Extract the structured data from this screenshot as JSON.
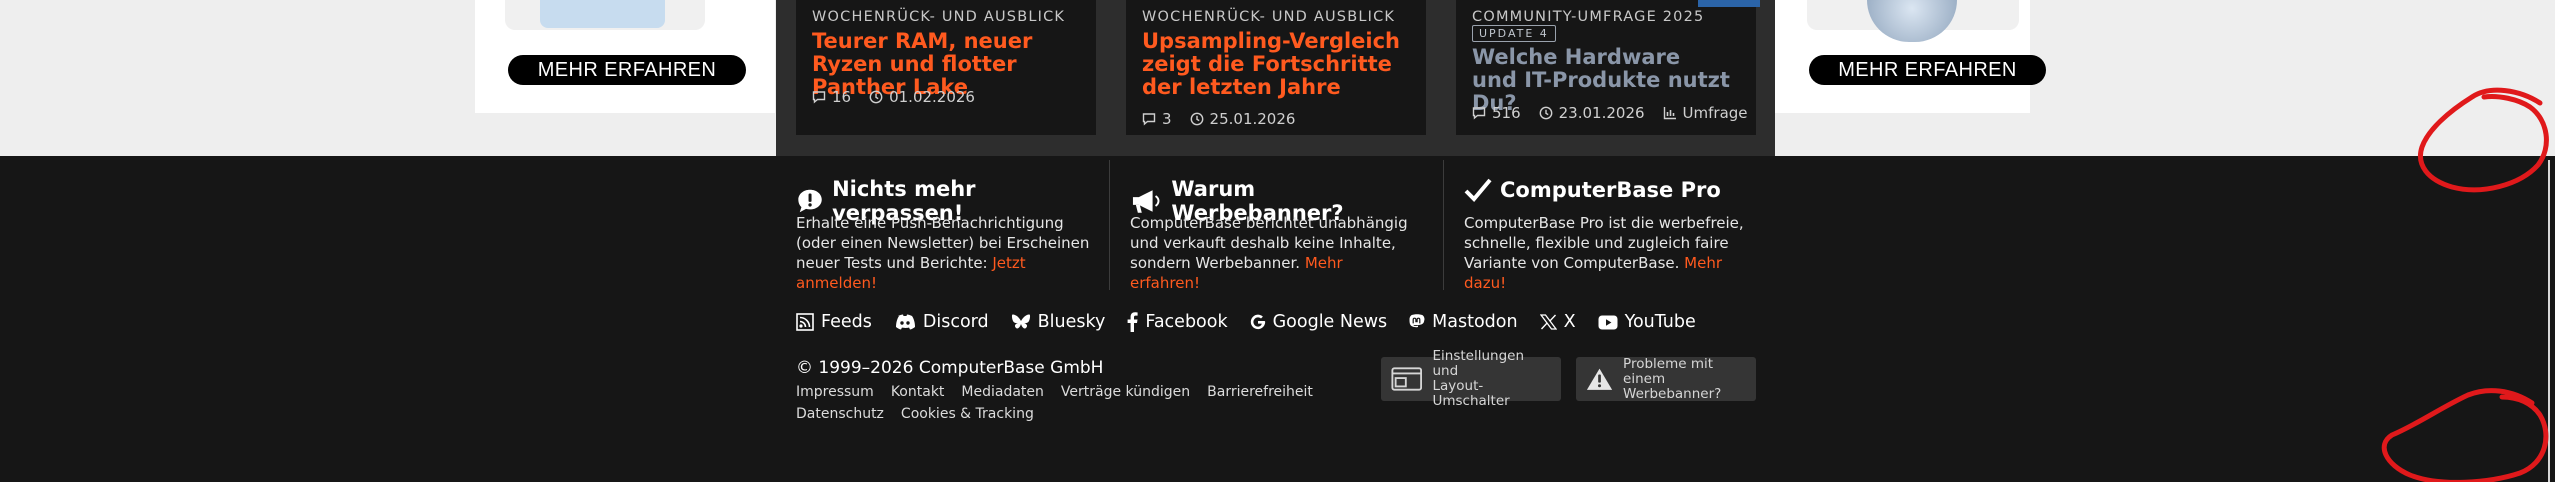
{
  "ads": {
    "left_button": "MEHR ERFAHREN",
    "right_button": "MEHR ERFAHREN"
  },
  "cards": [
    {
      "kicker": "WOCHENRÜCK- UND AUSBLICK",
      "headline": "Teurer RAM, neuer Ryzen und flotter Panther Lake",
      "comments": "16",
      "date": "01.02.2026"
    },
    {
      "kicker": "WOCHENRÜCK- UND AUSBLICK",
      "headline": "Upsampling-Vergleich zeigt die Fortschritte der letzten Jahre",
      "comments": "3",
      "date": "25.01.2026"
    },
    {
      "kicker": "COMMUNITY-UMFRAGE 2025",
      "badge": "UPDATE 4",
      "headline": "Welche Hardware und IT-Produkte nutzt Du?",
      "comments": "516",
      "date": "23.01.2026",
      "tag": "Umfrage"
    }
  ],
  "footer": {
    "col1": {
      "title": "Nichts mehr verpassen!",
      "text": "Erhalte eine Push-Benachrichtigung (oder einen Newsletter) bei Erscheinen neuer Tests und Berichte: ",
      "link": "Jetzt anmelden!"
    },
    "col2": {
      "title": "Warum Werbebanner?",
      "text": "ComputerBase berichtet unabhängig und verkauft deshalb keine Inhalte, sondern Werbebanner. ",
      "link": "Mehr erfahren!"
    },
    "col3": {
      "title": "ComputerBase Pro",
      "text": "ComputerBase Pro ist die werbefreie, schnelle, flexible und zugleich faire Variante von ComputerBase. ",
      "link": "Mehr dazu!"
    },
    "social": {
      "feeds": "Feeds",
      "discord": "Discord",
      "bluesky": "Bluesky",
      "facebook": "Facebook",
      "google_news": "Google News",
      "mastodon": "Mastodon",
      "x": "X",
      "youtube": "YouTube"
    },
    "copyright": "© 1999–2026 ComputerBase GmbH",
    "links": [
      "Impressum",
      "Kontakt",
      "Mediadaten",
      "Verträge kündigen",
      "Barrierefreiheit",
      "Datenschutz",
      "Cookies & Tracking"
    ],
    "settings_button": {
      "line1": "Einstellungen und",
      "line2": "Layout-Umschalter"
    },
    "problems_button": {
      "line1": "Probleme mit einem",
      "line2": "Werbebanner?"
    }
  },
  "colors": {
    "accent": "#ff5a1f",
    "dark": "#161616",
    "annotation": "#e0191b"
  },
  "icons": [
    "comment-icon",
    "clock-icon",
    "chart-icon",
    "bell-icon",
    "megaphone-icon",
    "check-icon",
    "rss-icon",
    "discord-icon",
    "bluesky-icon",
    "facebook-icon",
    "google-icon",
    "mastodon-icon",
    "x-icon",
    "youtube-icon",
    "layout-icon",
    "warning-icon"
  ]
}
